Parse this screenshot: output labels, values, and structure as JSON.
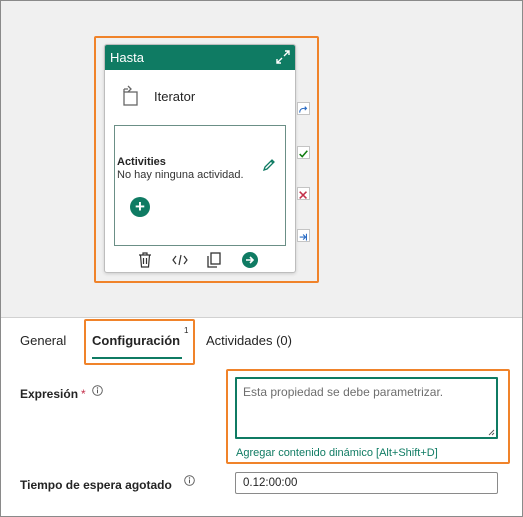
{
  "activity_card": {
    "title": "Hasta",
    "type_label": "Iterator",
    "activities_title": "Activities",
    "activities_empty": "No hay ninguna actividad."
  },
  "side_ports": [
    "skip-icon",
    "check-icon",
    "cross-icon",
    "arrow-right-icon"
  ],
  "toolbar_icons": [
    "trash-icon",
    "code-icon",
    "copy-icon",
    "arrow-circle-icon"
  ],
  "tabs": [
    {
      "label": "General",
      "active": false
    },
    {
      "label": "Configuración",
      "active": true,
      "badge": "1"
    },
    {
      "label": "Actividades (0)",
      "active": false
    }
  ],
  "form": {
    "expression_label": "Expresión",
    "required_mark": "*",
    "expression_placeholder": "Esta propiedad se debe parametrizar.",
    "dynamic_link": "Agregar contenido dinámico [Alt+Shift+D]",
    "timeout_label": "Tiempo de espera agotado",
    "timeout_value": "0.12:00:00"
  },
  "colors": {
    "accent": "#0f7b63",
    "highlight": "#f0832a",
    "error": "#c4314b"
  }
}
